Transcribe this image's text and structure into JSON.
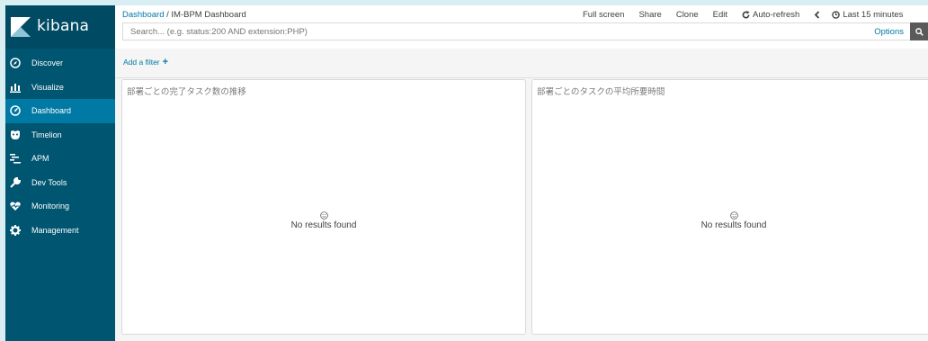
{
  "app": {
    "logo_text": "kibana"
  },
  "sidebar": {
    "items": [
      {
        "label": "Discover",
        "icon": "compass-icon"
      },
      {
        "label": "Visualize",
        "icon": "bar-chart-icon"
      },
      {
        "label": "Dashboard",
        "icon": "dashboard-icon",
        "active": true
      },
      {
        "label": "Timelion",
        "icon": "timelion-icon"
      },
      {
        "label": "APM",
        "icon": "apm-icon"
      },
      {
        "label": "Dev Tools",
        "icon": "wrench-icon"
      },
      {
        "label": "Monitoring",
        "icon": "heartbeat-icon"
      },
      {
        "label": "Management",
        "icon": "gear-icon"
      }
    ]
  },
  "header": {
    "breadcrumb_root": "Dashboard",
    "breadcrumb_sep": "/",
    "breadcrumb_current": "IM-BPM Dashboard",
    "menu": {
      "full_screen": "Full screen",
      "share": "Share",
      "clone": "Clone",
      "edit": "Edit",
      "auto_refresh": "Auto-refresh",
      "time_range": "Last 15 minutes"
    }
  },
  "search": {
    "placeholder": "Search... (e.g. status:200 AND extension:PHP)",
    "options_label": "Options"
  },
  "filter": {
    "add_label": "Add a filter",
    "plus": "+"
  },
  "panels": [
    {
      "title": "部署ごとの完了タスク数の推移",
      "empty_message": "No results found"
    },
    {
      "title": "部署ごとのタスクの平均所要時間",
      "empty_message": "No results found"
    }
  ],
  "colors": {
    "sidebar_bg": "#005571",
    "logo_bg": "#004a63",
    "active_item": "#0079a5",
    "link": "#0079a5"
  }
}
